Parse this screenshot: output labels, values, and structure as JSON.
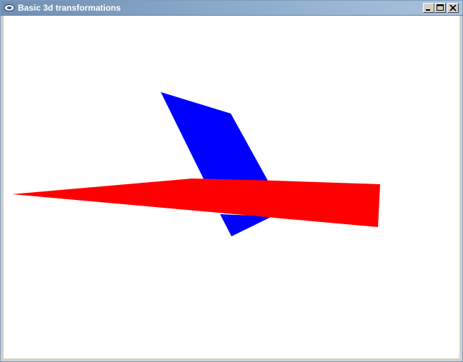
{
  "window": {
    "title": "Basic 3d transformations",
    "icon": "window-app-icon"
  },
  "title_buttons": {
    "minimize_icon": "minimize-icon",
    "maximize_icon": "maximize-icon",
    "close_icon": "close-icon"
  },
  "scene": {
    "background_color": "#ffffff",
    "shapes": [
      {
        "name": "blue-quad",
        "color": "#0000ff"
      },
      {
        "name": "red-quad",
        "color": "#ff0000"
      }
    ]
  }
}
